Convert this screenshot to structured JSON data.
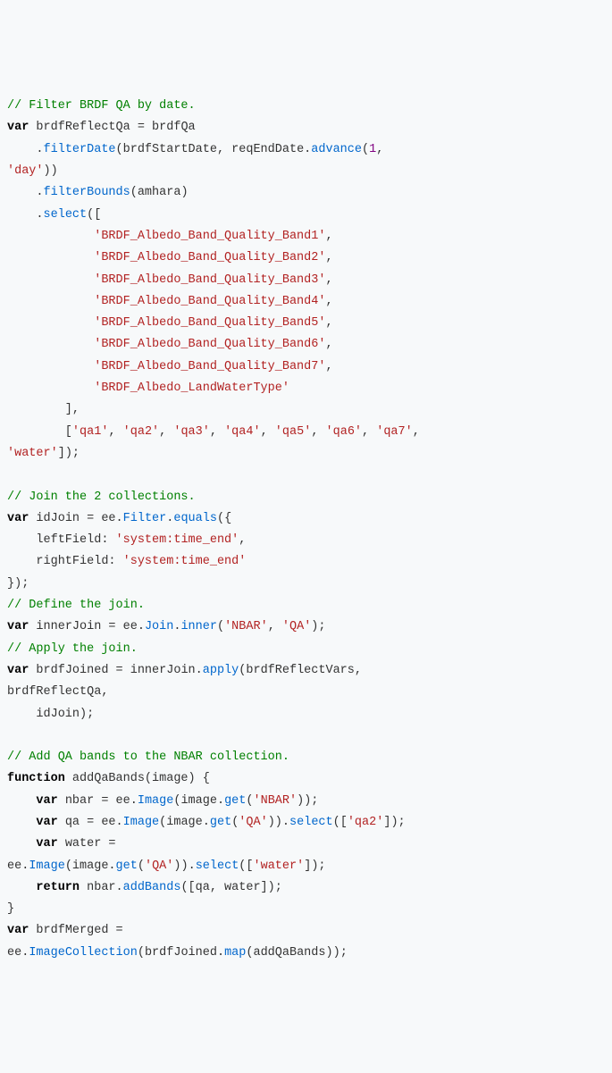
{
  "code": {
    "c1": "// Filter BRDF QA by date.",
    "k1": "var",
    "t1": " brdfReflectQa = brdfQa",
    "t2": "    .",
    "m1": "filterDate",
    "t3": "(brdfStartDate, reqEndDate.",
    "m2": "advance",
    "t4": "(",
    "n1": "1",
    "t5": ",",
    "s1": "'day'",
    "t6": "))",
    "t7": "    .",
    "m3": "filterBounds",
    "t8": "(amhara)",
    "t9": "    .",
    "m4": "select",
    "t10": "([",
    "s2": "'BRDF_Albedo_Band_Quality_Band1'",
    "s3": "'BRDF_Albedo_Band_Quality_Band2'",
    "s4": "'BRDF_Albedo_Band_Quality_Band3'",
    "s5": "'BRDF_Albedo_Band_Quality_Band4'",
    "s6": "'BRDF_Albedo_Band_Quality_Band5'",
    "s7": "'BRDF_Albedo_Band_Quality_Band6'",
    "s8": "'BRDF_Albedo_Band_Quality_Band7'",
    "s9": "'BRDF_Albedo_LandWaterType'",
    "t11": "        ],",
    "t12": "        [",
    "s10": "'qa1'",
    "s11": "'qa2'",
    "s12": "'qa3'",
    "s13": "'qa4'",
    "s14": "'qa5'",
    "s15": "'qa6'",
    "s16": "'qa7'",
    "s17": "'water'",
    "t13": "]);",
    "c2": "// Join the 2 collections.",
    "k2": "var",
    "t14": " idJoin = ee.",
    "m5": "Filter",
    "t15": ".",
    "m6": "equals",
    "t16": "({",
    "t17": "    leftField: ",
    "s18": "'system:time_end'",
    "t18": ",",
    "t19": "    rightField: ",
    "s19": "'system:time_end'",
    "t20": "});",
    "c3": "// Define the join.",
    "k3": "var",
    "t21": " innerJoin = ee.",
    "m7": "Join",
    "t22": ".",
    "m8": "inner",
    "t23": "(",
    "s20": "'NBAR'",
    "s21": "'QA'",
    "t24": ");",
    "c4": "// Apply the join.",
    "k4": "var",
    "t25": " brdfJoined = innerJoin.",
    "m9": "apply",
    "t26": "(brdfReflectVars,",
    "t27": "brdfReflectQa,",
    "t28": "    idJoin);",
    "c5": "// Add QA bands to the NBAR collection.",
    "k5": "function",
    "t29": " addQaBands(image) {",
    "k6": "var",
    "t30": " nbar = ee.",
    "m10": "Image",
    "t31": "(image.",
    "m11": "get",
    "t32": "(",
    "s22": "'NBAR'",
    "t33": "));",
    "k7": "var",
    "t34": " qa = ee.",
    "m12": "Image",
    "t35": "(image.",
    "m13": "get",
    "t36": "(",
    "s23": "'QA'",
    "t37": ")).",
    "m14": "select",
    "t38": "([",
    "s24": "'qa2'",
    "t39": "]);",
    "k8": "var",
    "t40": " water =",
    "t41": "ee.",
    "m15": "Image",
    "t42": "(image.",
    "m16": "get",
    "t43": "(",
    "s25": "'QA'",
    "t44": ")).",
    "m17": "select",
    "t45": "([",
    "s26": "'water'",
    "t46": "]);",
    "k9": "return",
    "t47": " nbar.",
    "m18": "addBands",
    "t48": "([qa, water]);",
    "t49": "}",
    "k10": "var",
    "t50": " brdfMerged =",
    "t51": "ee.",
    "m19": "ImageCollection",
    "t52": "(brdfJoined.",
    "m20": "map",
    "t53": "(addQaBands));",
    "comma": ", ",
    "pad12": "            ",
    "pad4": "    "
  }
}
